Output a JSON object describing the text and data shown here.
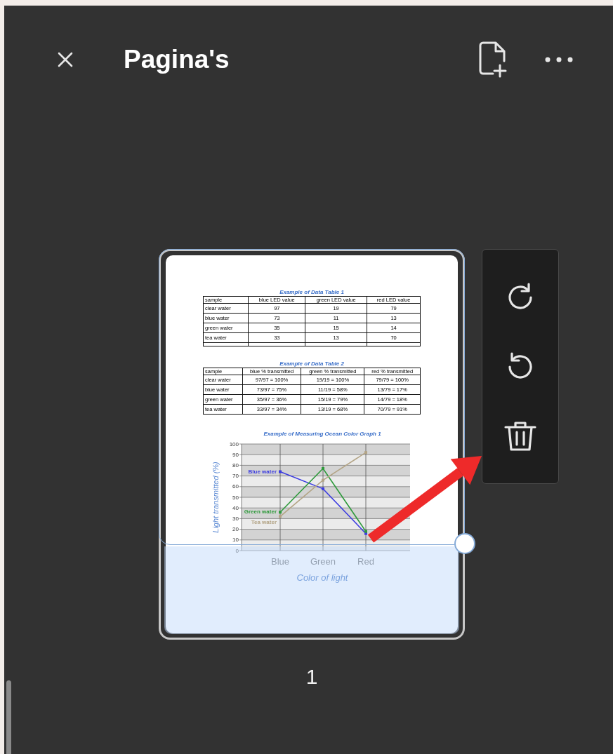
{
  "header": {
    "title": "Pagina's"
  },
  "page": {
    "number": "1",
    "tables": [
      {
        "title": "Example of Data Table 1",
        "columns": [
          "sample",
          "blue LED value",
          "green LED value",
          "red LED value"
        ],
        "rows": [
          [
            "clear water",
            "97",
            "19",
            "79"
          ],
          [
            "blue water",
            "73",
            "11",
            "13"
          ],
          [
            "green water",
            "35",
            "15",
            "14"
          ],
          [
            "tea water",
            "33",
            "13",
            "70"
          ]
        ]
      },
      {
        "title": "Example of Data Table 2",
        "columns": [
          "sample",
          "blue % transmitted",
          "green % transmitted",
          "red % transmitted"
        ],
        "rows": [
          [
            "clear water",
            "97/97 = 100%",
            "19/19 = 100%",
            "79/79 = 100%"
          ],
          [
            "blue water",
            "73/97 = 75%",
            "11/19 = 58%",
            "13/79 = 17%"
          ],
          [
            "green water",
            "35/97 = 36%",
            "15/19 = 79%",
            "14/79 = 18%"
          ],
          [
            "tea water",
            "33/97 = 34%",
            "13/19 = 68%",
            "70/79 = 91%"
          ]
        ]
      }
    ],
    "chart_data": {
      "type": "line",
      "grid": true,
      "title": "Example of Measuring Ocean Color Graph 1",
      "xlabel": "Color of light",
      "ylabel": "Light transmitted (%)",
      "categories": [
        "Blue",
        "Green",
        "Red"
      ],
      "ylim": [
        0,
        100
      ],
      "yticks": [
        0,
        10,
        20,
        30,
        40,
        50,
        60,
        70,
        80,
        90,
        100
      ],
      "series": [
        {
          "name": "Blue water",
          "color": "#3d3de0",
          "marker": "square",
          "values": [
            74,
            58,
            16
          ]
        },
        {
          "name": "Green water",
          "color": "#2f9a3c",
          "marker": "square",
          "values": [
            36,
            77,
            18
          ]
        },
        {
          "name": "Tea water",
          "color": "#b3a486",
          "marker": "square",
          "values": [
            32,
            66,
            92
          ]
        }
      ]
    }
  }
}
